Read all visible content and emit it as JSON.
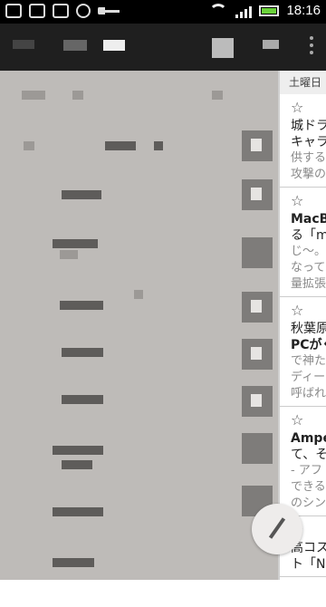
{
  "status_bar": {
    "time": "18:16",
    "icons": [
      "landscape-notification-icon",
      "m-logo-icon",
      "image-icon",
      "e-icon",
      "key-icon",
      "wifi-icon",
      "signal-icon",
      "battery-icon"
    ]
  },
  "mail_list": {
    "date_header": "土曜日",
    "items": [
      {
        "line1": "城ドラ",
        "line2": "キャラ",
        "line3": "供する",
        "line4": "攻撃の"
      },
      {
        "line1": "MacB",
        "line2": "る「m",
        "line3": "じ〜。",
        "line4": "なって",
        "line5": "量拡張"
      },
      {
        "line1": "秋葉原",
        "line2": "PCがく",
        "line3": "で神た",
        "line4": "ディー",
        "line5": "呼ばれ"
      },
      {
        "line1": "Ampe",
        "line2": "て、そ",
        "line3": "- アフ",
        "line4": "できる",
        "line5": "のシン"
      },
      {
        "line1": "高コス",
        "line2": "ト「N"
      }
    ]
  },
  "colors": {
    "drawer_bg": "#bebbb8",
    "battery": "#6ad13a",
    "actionbar": "#1f1f1f"
  }
}
